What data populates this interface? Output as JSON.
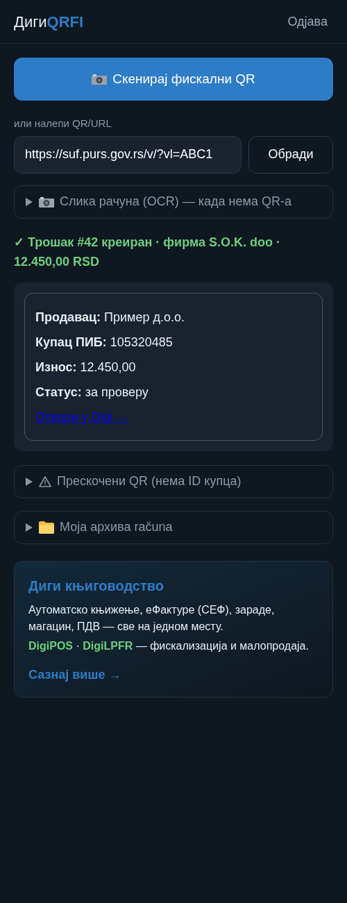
{
  "header": {
    "brand_prefix": "Диги",
    "brand_accent": "QRFI",
    "logout": "Одјава"
  },
  "scan_button": {
    "label": "Скенирај фискални QR"
  },
  "paste": {
    "label": "или налепи QR/URL",
    "value": "https://suf.purs.gov.rs/v/?vl=ABC1",
    "button": "Обради"
  },
  "ocr_section": {
    "label": "Слика рачуна (OCR) — када нема QR-а",
    "expanded": false
  },
  "result_message": "✓ Трошак #42 креиран · фирма S.O.K. doo · 12.450,00 RSD",
  "receipt": {
    "lines": [
      "**Продавац:** Пример д.о.о.",
      "**Купац ПИБ:** 105320485",
      "**Износ:** 12.450,00",
      "**Статус:** за проверу"
    ],
    "link": "Отвори у Digi →"
  },
  "sections": [
    {
      "kind": "warning",
      "label": "Прескочени QR (нема ID купца)",
      "expanded": false
    },
    {
      "kind": "folder",
      "label": "Моја архива računa",
      "expanded": false
    }
  ],
  "promo": {
    "title": "Диги књиговодство",
    "text": "Аутоматско књижење, еФактуре (СЕФ), зараде, магацин, ПДВ — све на једном месту.",
    "products": "**DigiPOS** · **DigiLPFR** — фискализација и малопродаја.",
    "link": "Сазнај више →"
  }
}
